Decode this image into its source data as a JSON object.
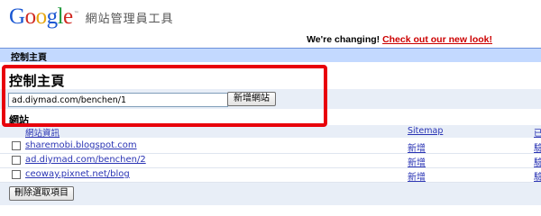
{
  "header": {
    "logo_text": "Google",
    "logo_tm": "™",
    "product": "網站管理員工具",
    "notice_prefix": "We're changing!",
    "notice_link": "Check out our new look!"
  },
  "topbar": {
    "title": "控制主頁"
  },
  "main": {
    "heading": "控制主頁",
    "add_site": {
      "value": "ad.diymad.com/benchen/1",
      "button": "新增網站"
    },
    "sites_label": "網站",
    "columns": {
      "site_info": "網站資訊",
      "sitemap": "Sitemap",
      "verified": "已"
    },
    "sites": [
      {
        "url": "sharemobi.blogspot.com",
        "sitemap_action": "新增",
        "verify": "驗"
      },
      {
        "url": "ad.diymad.com/benchen/2",
        "sitemap_action": "新增",
        "verify": "驗"
      },
      {
        "url": "ceoway.pixnet.net/blog",
        "sitemap_action": "新增",
        "verify": "驗"
      }
    ],
    "delete_button": "刪除選取項目"
  },
  "colors": {
    "topbar_bg": "#c3d9ff",
    "row_band_bg": "#e8eef7",
    "link": "#2a34b4",
    "notice_link": "#cc0000",
    "highlight_border": "#e8000b"
  },
  "icons": [
    "checkbox-icon"
  ]
}
